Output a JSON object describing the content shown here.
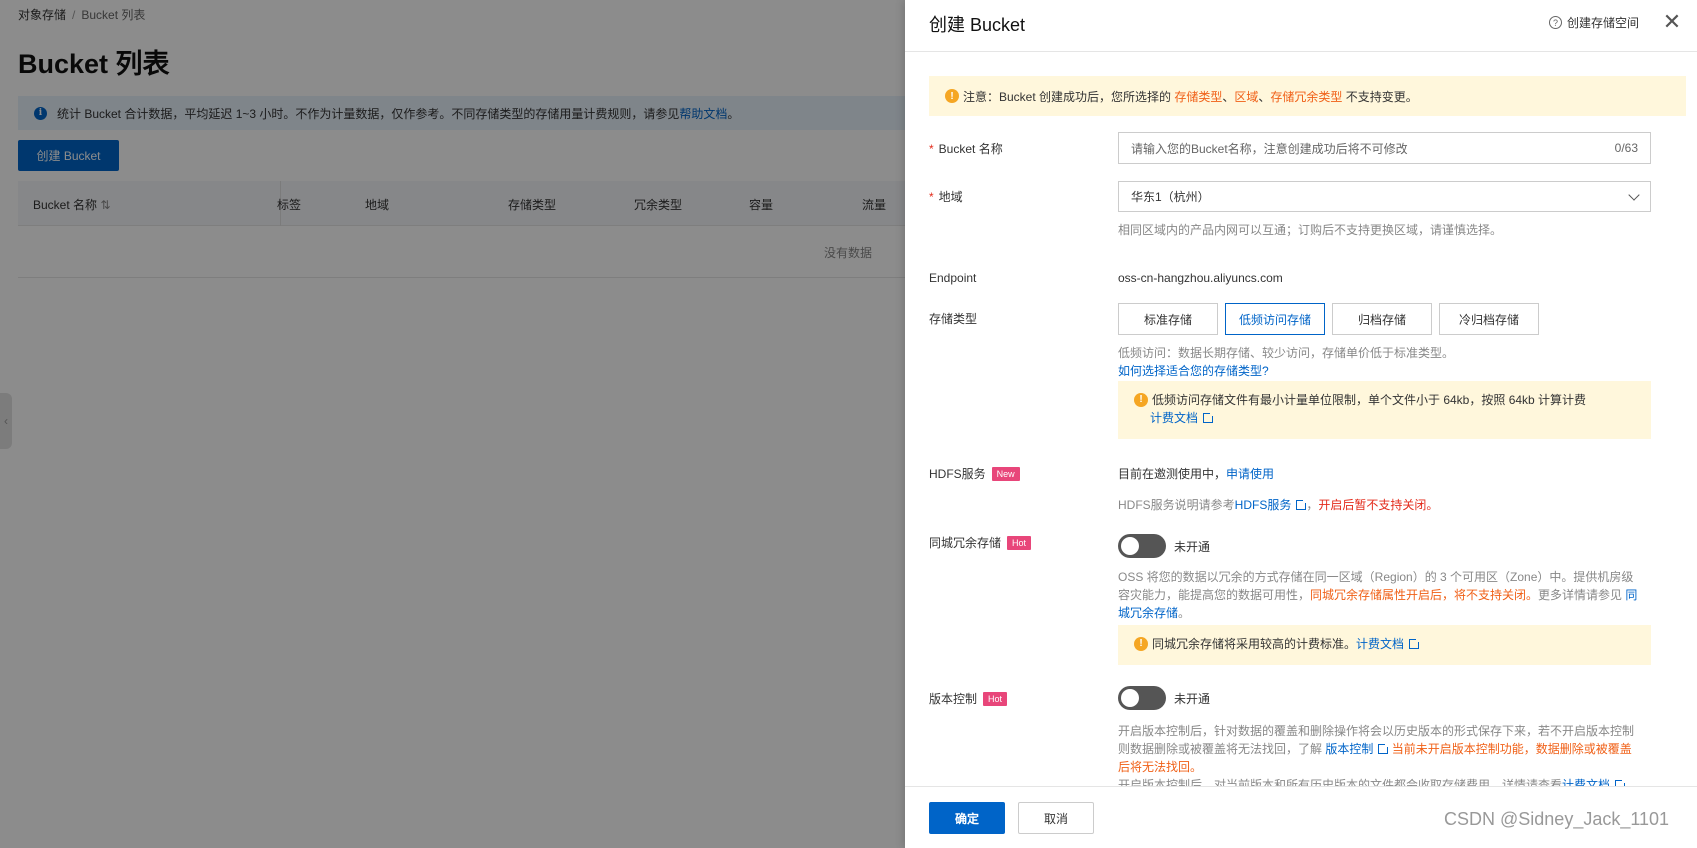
{
  "bg": {
    "breadcrumb": {
      "root": "对象存储",
      "sep": "/",
      "current": "Bucket 列表"
    },
    "title": "Bucket 列表",
    "banner": {
      "text": "统计 Bucket 合计数据，平均延迟 1~3 小时。不作为计量数据，仅作参考。不同存储类型的存储用量计费规则，请参见",
      "link": "帮助文档",
      "end": "。"
    },
    "create_button": "创建 Bucket",
    "table": {
      "columns": [
        "Bucket 名称",
        "标签",
        "地域",
        "存储类型",
        "冗余类型",
        "容量",
        "流量"
      ],
      "empty": "没有数据"
    }
  },
  "drawer": {
    "title": "创建 Bucket",
    "help_link": "创建存储空间",
    "notice": {
      "prefix": "注意：Bucket 创建成功后，您所选择的 ",
      "t1": "存储类型",
      "s1": "、",
      "t2": "区域",
      "s2": "、",
      "t3": "存储冗余类型",
      "suffix": " 不支持变更。"
    },
    "name": {
      "label": "Bucket 名称",
      "required": "*",
      "placeholder": "请输入您的Bucket名称，注意创建成功后将不可修改",
      "counter": "0/63"
    },
    "region": {
      "label": "地域",
      "required": "*",
      "value": "华东1（杭州）",
      "hint": "相同区域内的产品内网可以互通；订购后不支持更换区域，请谨慎选择。"
    },
    "endpoint": {
      "label": "Endpoint",
      "value": "oss-cn-hangzhou.aliyuncs.com"
    },
    "storage": {
      "label": "存储类型",
      "options": [
        "标准存储",
        "低频访问存储",
        "归档存储",
        "冷归档存储"
      ],
      "hint": "低频访问：数据长期存储、较少访问，存储单价低于标准类型。",
      "how_link": "如何选择适合您的存储类型?",
      "warn": "低频访问存储文件有最小计量单位限制，单个文件小于 64kb，按照 64kb 计算计费",
      "warn_link": "计费文档"
    },
    "hdfs": {
      "label": "HDFS服务",
      "tag": "New",
      "status": "目前在邀测使用中，",
      "apply": "申请使用",
      "hint_prefix": "HDFS服务说明请参考",
      "hint_link": "HDFS服务",
      "hint_sep": "，",
      "hint_red": "开启后暂不支持关闭。"
    },
    "zrs": {
      "label": "同城冗余存储",
      "tag": "Hot",
      "toggle": "未开通",
      "desc1": "OSS 将您的数据以冗余的方式存储在同一区域（Region）的 3 个可用区（Zone）中。提供机房级",
      "desc2a": "容灾能力，能提高您的数据可用性，",
      "desc2b": "同城冗余存储属性开启后，将不支持关闭。",
      "desc2c": "更多详情请参见 ",
      "desc2d": "同",
      "desc3": "城冗余存储",
      "desc3e": "。",
      "warn": "同城冗余存储将采用较高的计费标准。",
      "warn_link": "计费文档"
    },
    "versioning": {
      "label": "版本控制",
      "tag": "Hot",
      "toggle": "未开通",
      "desc1": "开启版本控制后，针对数据的覆盖和删除操作将会以历史版本的形式保存下来，若不开启版本控制",
      "desc2a": "则数据删除或被覆盖将无法找回，了解 ",
      "desc2b": "版本控制",
      "desc2c": "当前未开启版本控制功能，数据删除或被覆盖",
      "desc3": "后将无法找回。",
      "desc4a": "开启版本控制后，对当前版本和所有历史版本的文件都会收取存储费用，详情请查看",
      "desc4b": "计费文档"
    },
    "footer": {
      "ok": "确定",
      "cancel": "取消",
      "watermark": "CSDN @Sidney_Jack_1101"
    }
  }
}
